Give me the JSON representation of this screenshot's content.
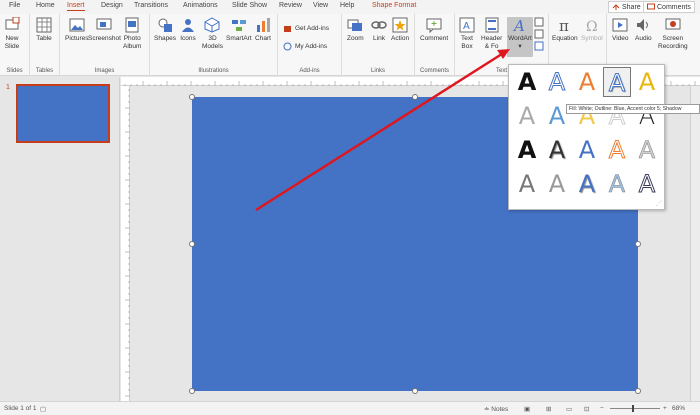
{
  "menu": {
    "tabs": [
      "File",
      "Home",
      "Insert",
      "Design",
      "Transitions",
      "Animations",
      "Slide Show",
      "Review",
      "View",
      "Help",
      "Shape Format"
    ],
    "active": "Insert",
    "share": "Share",
    "comments": "Comments"
  },
  "ribbon": {
    "slides": {
      "new_slide": "New",
      "new_slide2": "Slide",
      "label": "Slides"
    },
    "tables": {
      "table": "Table",
      "label": "Tables"
    },
    "images": {
      "pictures": "Pictures",
      "screenshot": "Screenshot",
      "photo_album": "Photo",
      "photo_album2": "Album",
      "label": "Images"
    },
    "illustrations": {
      "shapes": "Shapes",
      "icons": "Icons",
      "models": "3D",
      "models2": "Models",
      "smartart": "SmartArt",
      "chart": "Chart",
      "label": "Illustrations"
    },
    "addins": {
      "get": "Get Add-ins",
      "my": "My Add-ins",
      "label": "Add-ins"
    },
    "links": {
      "zoom": "Zoom",
      "link": "Link",
      "action": "Action",
      "label": "Links"
    },
    "comments": {
      "comment": "Comment",
      "label": "Comments"
    },
    "text": {
      "text_box": "Text",
      "text_box2": "Box",
      "header": "Header",
      "header2": "& Fo",
      "wordart": "WordArt",
      "label": "Text"
    },
    "symbols": {
      "equation": "Equation",
      "symbol": "Symbol"
    },
    "media": {
      "video": "Video",
      "audio": "Audio",
      "screen": "Screen",
      "screen2": "Recording"
    }
  },
  "thumbs": {
    "slide_number": "1"
  },
  "tooltip": "Fill: White; Outline: Blue, Accent color 5; Shadow",
  "gallery": {
    "rows": [
      [
        {
          "style": "black",
          "c": "#111111"
        },
        {
          "style": "blue-outline",
          "c": "#4472c4"
        },
        {
          "style": "orange",
          "c": "#ed7d31"
        },
        {
          "style": "white-outline",
          "c": "#4472c4"
        },
        {
          "style": "gold",
          "c": "#e8b70a"
        }
      ],
      [
        {
          "style": "gray-light",
          "c": "#aaaaaa"
        },
        {
          "style": "blue-grad",
          "c": "#5b9bd5"
        },
        {
          "style": "gold-light",
          "c": "#f2c94c"
        },
        {
          "style": "white",
          "c": "#cccccc"
        },
        {
          "style": "black-thin",
          "c": "#222222"
        }
      ],
      [
        {
          "style": "black-bold",
          "c": "#111111"
        },
        {
          "style": "shadow",
          "c": "#333333"
        },
        {
          "style": "blue",
          "c": "#4472c4"
        },
        {
          "style": "orange-outline",
          "c": "#ed7d31"
        },
        {
          "style": "silver",
          "c": "#d0d0d0"
        }
      ],
      [
        {
          "style": "gray",
          "c": "#777777"
        },
        {
          "style": "gray2",
          "c": "#999999"
        },
        {
          "style": "blue-bevel",
          "c": "#4472c4"
        },
        {
          "style": "blue-pale",
          "c": "#9dc3e6"
        },
        {
          "style": "dark-outline",
          "c": "#3a3a5a"
        }
      ]
    ],
    "glyph": "A"
  },
  "status": {
    "slide": "Slide 1 of 1",
    "notes": "Notes",
    "zoom": "68%"
  },
  "colors": {
    "accent": "#c43e1c",
    "slide_fill": "#4472c4",
    "arrow": "#e0161e"
  }
}
